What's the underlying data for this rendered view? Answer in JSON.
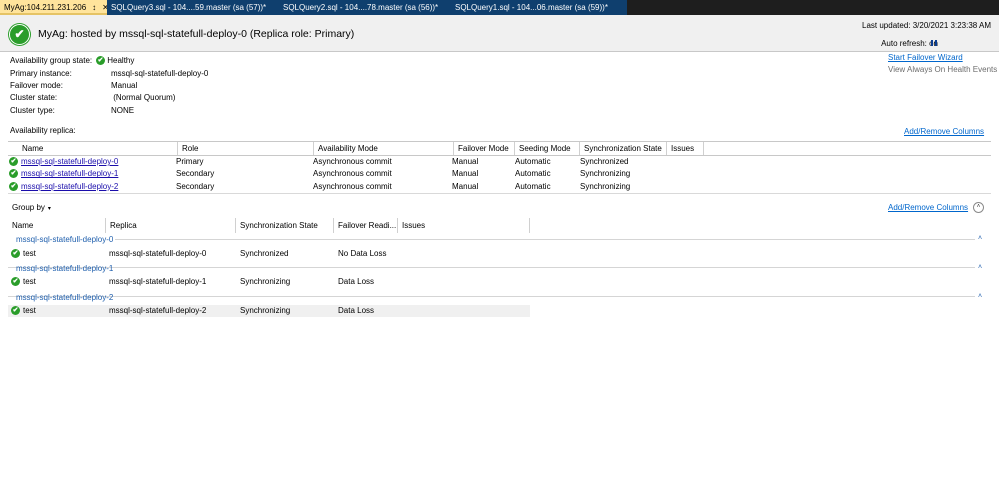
{
  "tabs": [
    {
      "label": "MyAg:104.211.231.206",
      "pin": "↕",
      "close": "✕"
    },
    {
      "label": "SQLQuery3.sql - 104....59.master (sa (57))*"
    },
    {
      "label": "SQLQuery2.sql - 104....78.master (sa (56))*"
    },
    {
      "label": "SQLQuery1.sql - 104...06.master (sa (59))*"
    }
  ],
  "header": {
    "title": "MyAg: hosted by mssql-sql-statefull-deploy-0 (Replica role: Primary)",
    "last_updated": "Last updated: 3/20/2021 3:23:38 AM",
    "auto_refresh": "Auto refresh: on"
  },
  "properties": [
    {
      "label": "Availability group state:",
      "value": "Healthy"
    },
    {
      "label": "Primary instance:",
      "value": "mssql-sql-statefull-deploy-0"
    },
    {
      "label": "Failover mode:",
      "value": "Manual"
    },
    {
      "label": "Cluster state:",
      "value": " (Normal Quorum)"
    },
    {
      "label": "Cluster type:",
      "value": "NONE"
    }
  ],
  "links": {
    "start_failover": "Start Failover Wizard",
    "view_health_events": "View Always On Health Events",
    "add_remove_columns": "Add/Remove Columns"
  },
  "replica_section": {
    "label": "Availability replica:",
    "columns": [
      "Name",
      "Role",
      "Availability Mode",
      "Failover Mode",
      "Seeding Mode",
      "Synchronization State",
      "Issues"
    ],
    "rows": [
      {
        "name": "mssql-sql-statefull-deploy-0",
        "role": "Primary",
        "availability_mode": "Asynchronous commit",
        "failover_mode": "Manual",
        "seeding_mode": "Automatic",
        "sync_state": "Synchronized",
        "issues": ""
      },
      {
        "name": "mssql-sql-statefull-deploy-1",
        "role": "Secondary",
        "availability_mode": "Asynchronous commit",
        "failover_mode": "Manual",
        "seeding_mode": "Automatic",
        "sync_state": "Synchronizing",
        "issues": ""
      },
      {
        "name": "mssql-sql-statefull-deploy-2",
        "role": "Secondary",
        "availability_mode": "Asynchronous commit",
        "failover_mode": "Manual",
        "seeding_mode": "Automatic",
        "sync_state": "Synchronizing",
        "issues": ""
      }
    ]
  },
  "database_section": {
    "group_by": "Group by",
    "columns": [
      "Name",
      "Replica",
      "Synchronization State",
      "Failover Readi...",
      "Issues"
    ],
    "groups": [
      {
        "header": "mssql-sql-statefull-deploy-0",
        "rows": [
          {
            "name": "test",
            "replica": "mssql-sql-statefull-deploy-0",
            "sync_state": "Synchronized",
            "failover_readiness": "No Data Loss",
            "issues": ""
          }
        ]
      },
      {
        "header": "mssql-sql-statefull-deploy-1",
        "rows": [
          {
            "name": "test",
            "replica": "mssql-sql-statefull-deploy-1",
            "sync_state": "Synchronizing",
            "failover_readiness": "Data Loss",
            "issues": ""
          }
        ]
      },
      {
        "header": "mssql-sql-statefull-deploy-2",
        "rows": [
          {
            "name": "test",
            "replica": "mssql-sql-statefull-deploy-2",
            "sync_state": "Synchronizing",
            "failover_readiness": "Data Loss",
            "issues": ""
          }
        ]
      }
    ]
  },
  "icons": {
    "check": "✔",
    "caret_down": "▾",
    "caret_up": "˄",
    "collapse": "˄"
  },
  "colors": {
    "active_tab": "#ffe49c",
    "healthy_green": "#2a9d2a",
    "link_blue": "#1a0dab",
    "group_blue": "#1f5fad"
  }
}
